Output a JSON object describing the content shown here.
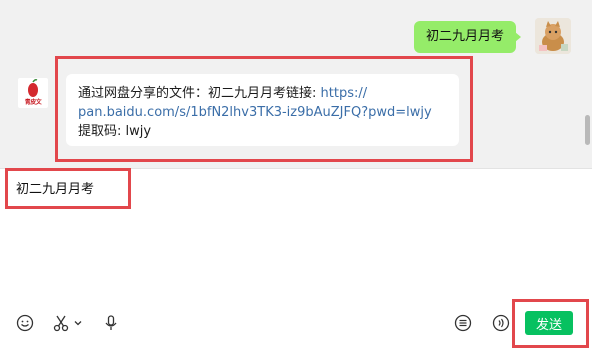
{
  "chat": {
    "self_message": "初二九月月考",
    "other_message": {
      "prefix": "通过网盘分享的文件：初二九月月考链接: ",
      "link_part1": "https://",
      "link_part2": "pan.baidu.com/s/1bfN2lhv3TK3-iz9bAuZJFQ?pwd=lwjy",
      "code_line": "提取码: lwjy"
    },
    "other_avatar_logo": "青皮文"
  },
  "input": {
    "value": "初二九月月考"
  },
  "toolbar": {
    "emoji_icon": "smiley-icon",
    "scissors_icon": "scissors-icon",
    "dropdown_icon": "chevron-down-icon",
    "voice_icon": "microphone-icon",
    "history_icon": "list-icon",
    "voice_input_icon": "voice-wave-icon",
    "send_label": "发送"
  },
  "colors": {
    "self_bubble": "#95ec69",
    "send_button": "#07c160",
    "highlight": "#e2474c",
    "link": "#3b6ea8"
  }
}
